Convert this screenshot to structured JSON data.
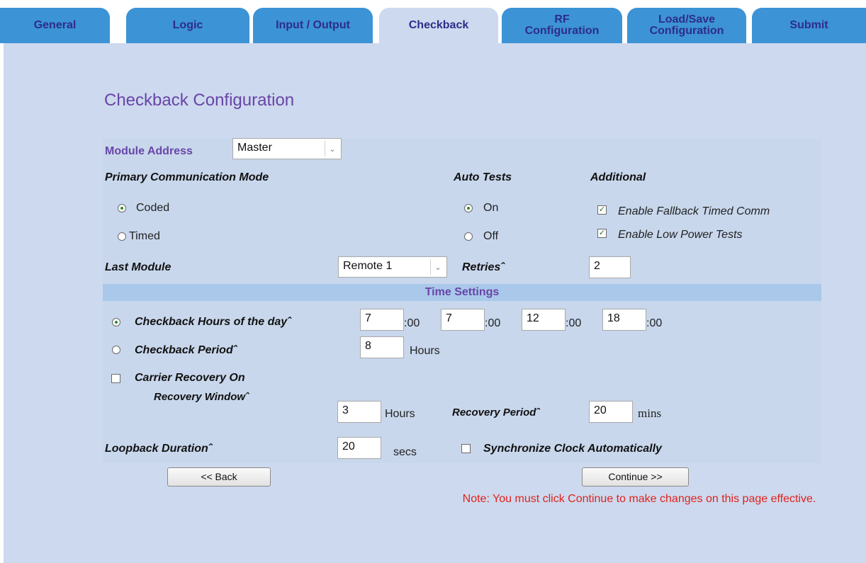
{
  "tabs": [
    {
      "label": "General"
    },
    {
      "label": "Logic"
    },
    {
      "label": "Input / Output"
    },
    {
      "label": "Checkback"
    },
    {
      "label": "RF Configuration"
    },
    {
      "label": "Load/Save Configuration"
    },
    {
      "label": "Submit"
    }
  ],
  "active_tab": "Checkback",
  "page_title": "Checkback Configuration",
  "module_address": {
    "label": "Module Address",
    "value": "Master"
  },
  "primary_comm": {
    "header": "Primary Communication Mode",
    "coded": "Coded",
    "timed": "Timed",
    "selected": "Coded"
  },
  "auto_tests": {
    "header": "Auto Tests",
    "on": "On",
    "off": "Off",
    "selected": "On"
  },
  "additional": {
    "header": "Additional",
    "fallback": {
      "label": "Enable Fallback Timed Comm",
      "checked": true
    },
    "low_power": {
      "label": "Enable Low Power Tests",
      "checked": true
    }
  },
  "last_module": {
    "label": "Last Module",
    "value": "Remote 1"
  },
  "retries": {
    "label": "Retriesˆ",
    "value": "2"
  },
  "time_settings": {
    "header": "Time Settings",
    "hours_of_day": {
      "label": "Checkback Hours of the dayˆ",
      "selected": true,
      "values": [
        "7",
        "7",
        "12",
        "18"
      ],
      "suffix": ":00"
    },
    "period": {
      "label": "Checkback Periodˆ",
      "value": "8",
      "unit": "Hours"
    },
    "carrier_recovery": {
      "label": "Carrier Recovery On",
      "checked": false
    },
    "recovery_window": {
      "label": "Recovery Windowˆ",
      "value": "3",
      "unit": "Hours"
    },
    "recovery_period": {
      "label": "Recovery Periodˆ",
      "value": "20",
      "unit": "mins"
    },
    "loopback": {
      "label": "Loopback Durationˆ",
      "value": "20",
      "unit": "secs"
    },
    "sync_clock": {
      "label": "Synchronize Clock Automatically",
      "checked": false
    }
  },
  "buttons": {
    "back": "<< Back",
    "continue": "Continue >>"
  },
  "note": "Note: You must click Continue to make changes on this page effective.",
  "colors": {
    "tab": "#3c93d5",
    "tab_active": "#cdd9ee",
    "background": "#cdd9ee",
    "title": "#6845a8",
    "note": "#e0231e"
  }
}
